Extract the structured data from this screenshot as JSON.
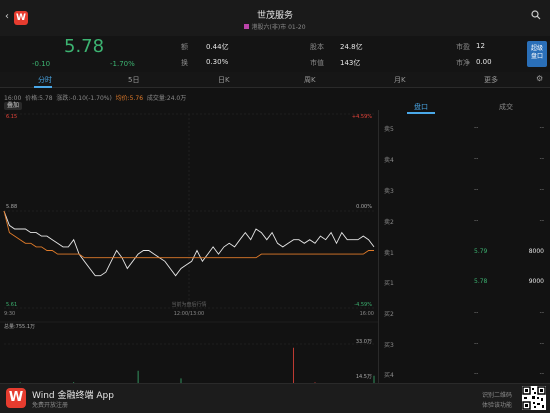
{
  "header": {
    "title": "世茂服务",
    "subtitle": "港股六(非)市 01-20",
    "logo_text": "W"
  },
  "quote": {
    "price": "5.78",
    "change": "-0.10",
    "change_pct": "-1.70%",
    "stats": [
      {
        "label": "额",
        "value": "0.44亿"
      },
      {
        "label": "换",
        "value": "0.30%"
      },
      {
        "label": "股本",
        "value": "24.8亿"
      },
      {
        "label": "市值",
        "value": "143亿"
      },
      {
        "label": "市盈",
        "value": "12"
      },
      {
        "label": "市净",
        "value": "0.00"
      }
    ],
    "side_button": "超级\n盘口"
  },
  "tabs": [
    "分时",
    "5日",
    "日K",
    "周K",
    "月K",
    "更多"
  ],
  "chart_info": {
    "time": "16:00",
    "price_label": "价格:5.78",
    "change_label": "涨跌:-0.10(-1.70%)",
    "avg_label": "均价:5.76",
    "volume_label": "成交量:24.0万",
    "overlay_button": "叠加",
    "y_top": "6.15",
    "y_mid": "5.88",
    "y_bottom": "5.61",
    "pct_top": "+4.59%",
    "pct_mid": "0.00%",
    "pct_bottom": "-4.59%",
    "x_start": "9:30",
    "x_mid": "12:00/13:00",
    "x_end": "16:00",
    "watermark": "当前为盘后行情",
    "vol_title": "总量:755.1万",
    "vol_top": "33.0万",
    "vol_mid": "14.5万"
  },
  "chart_data": {
    "type": "line",
    "series": [
      {
        "name": "价格",
        "values": [
          5.88,
          5.84,
          5.83,
          5.83,
          5.83,
          5.82,
          5.82,
          5.81,
          5.81,
          5.8,
          5.79,
          5.78,
          5.78,
          5.8,
          5.76,
          5.74,
          5.72,
          5.7,
          5.7,
          5.71,
          5.74,
          5.77,
          5.75,
          5.72,
          5.74,
          5.76,
          5.77,
          5.77,
          5.76,
          5.75,
          5.74,
          5.72,
          5.7,
          5.72,
          5.73,
          5.74,
          5.77,
          5.74,
          5.76,
          5.78,
          5.76,
          5.78,
          5.79,
          5.78,
          5.8,
          5.82,
          5.8,
          5.83,
          5.82,
          5.8,
          5.82,
          5.79,
          5.78,
          5.79,
          5.8,
          5.8,
          5.79,
          5.8,
          5.79,
          5.81,
          5.8,
          5.82,
          5.79,
          5.82,
          5.8,
          5.8,
          5.8,
          5.81,
          5.8,
          5.78
        ]
      },
      {
        "name": "均价",
        "values": [
          5.88,
          5.82,
          5.81,
          5.8,
          5.79,
          5.79,
          5.78,
          5.78,
          5.77,
          5.77,
          5.76,
          5.76,
          5.76,
          5.76,
          5.76,
          5.75,
          5.75,
          5.75,
          5.75,
          5.75,
          5.75,
          5.75,
          5.75,
          5.75,
          5.75,
          5.75,
          5.75,
          5.75,
          5.75,
          5.75,
          5.75,
          5.75,
          5.75,
          5.75,
          5.75,
          5.75,
          5.75,
          5.75,
          5.75,
          5.75,
          5.75,
          5.75,
          5.75,
          5.75,
          5.75,
          5.75,
          5.75,
          5.75,
          5.76,
          5.76,
          5.76,
          5.76,
          5.76,
          5.76,
          5.76,
          5.76,
          5.76,
          5.76,
          5.76,
          5.76,
          5.76,
          5.76,
          5.76,
          5.76,
          5.76,
          5.76,
          5.76,
          5.76,
          5.77,
          5.77
        ]
      }
    ],
    "ylim": [
      5.61,
      6.15
    ],
    "volumes": [
      2,
      1,
      1,
      3,
      1,
      2,
      1,
      1,
      2,
      1,
      1,
      1,
      2,
      3,
      1,
      1,
      1,
      2,
      2,
      1,
      1,
      1,
      1,
      2,
      1,
      12,
      1,
      1,
      2,
      1,
      1,
      1,
      1,
      6,
      1,
      1,
      2,
      1,
      1,
      1,
      1,
      1,
      1,
      1,
      1,
      2,
      1,
      1,
      1,
      1,
      1,
      1,
      1,
      1,
      30,
      1,
      1,
      1,
      3,
      1,
      1,
      1,
      1,
      1,
      1,
      1,
      1,
      1,
      2,
      8
    ]
  },
  "orderbook": {
    "tabs": [
      "盘口",
      "成交"
    ],
    "rows": [
      {
        "label": "卖5",
        "price": "--",
        "vol": "--"
      },
      {
        "label": "卖4",
        "price": "--",
        "vol": "--"
      },
      {
        "label": "卖3",
        "price": "--",
        "vol": "--"
      },
      {
        "label": "卖2",
        "price": "--",
        "vol": "--"
      },
      {
        "label": "卖1",
        "price": "5.79",
        "vol": "8000"
      },
      {
        "label": "买1",
        "price": "5.78",
        "vol": "9000"
      },
      {
        "label": "买2",
        "price": "--",
        "vol": "--"
      },
      {
        "label": "买3",
        "price": "--",
        "vol": "--"
      },
      {
        "label": "买4",
        "price": "--",
        "vol": "--"
      }
    ]
  },
  "footer": {
    "app_name": "Wind 金融终端 App",
    "app_sub": "免费开放注册",
    "qr_text_1": "识别二维码",
    "qr_text_2": "体验该功能"
  },
  "colors": {
    "up": "#e8443a",
    "down": "#3cb371",
    "accent": "#4aa8e8",
    "avg": "#e07b2a"
  }
}
